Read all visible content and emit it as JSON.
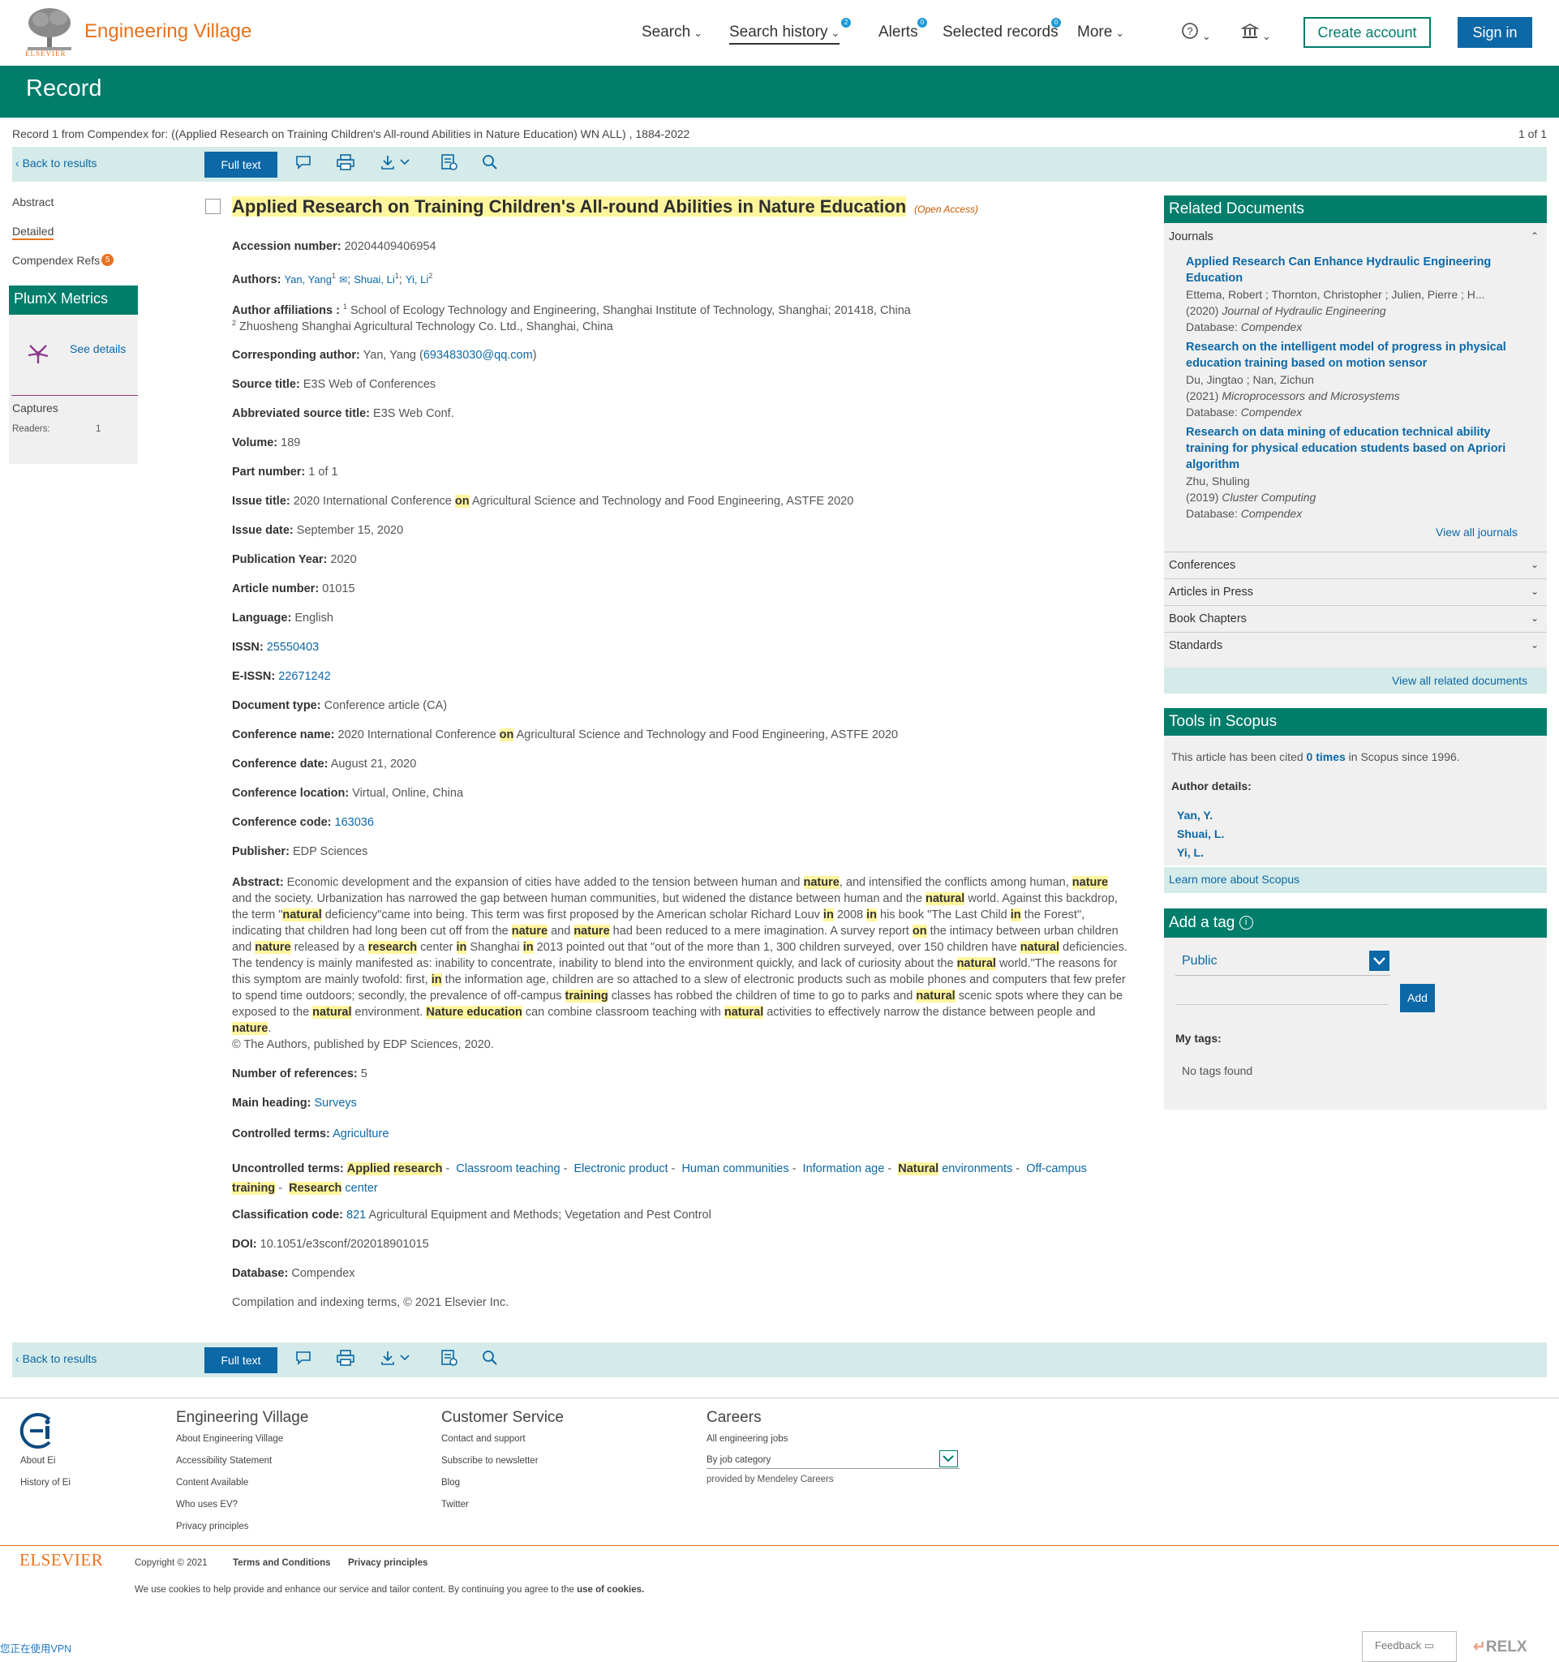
{
  "header": {
    "brand": "Engineering Village",
    "publisher_small": "ELSEVIER",
    "nav": [
      {
        "label": "Search",
        "badge": ""
      },
      {
        "label": "Search history",
        "badge": "2"
      },
      {
        "label": "Alerts",
        "badge": "0"
      },
      {
        "label": "Selected records",
        "badge": "0"
      },
      {
        "label": "More",
        "badge": ""
      }
    ],
    "help_icon": "question-circle-icon",
    "institution_icon": "institution-icon",
    "create_account": "Create account",
    "sign_in": "Sign in"
  },
  "page": {
    "title": "Record",
    "record_info": "Record 1 from Compendex for: ((Applied Research on Training Children's All-round Abilities in Nature Education) WN ALL) , 1884-2022",
    "record_count": "1 of 1",
    "back_to_results": "Back to results",
    "full_text": "Full text"
  },
  "sidebar": {
    "abstract": "Abstract",
    "detailed": "Detailed",
    "compendex_refs": "Compendex Refs",
    "refs_count": "5",
    "plumx_title": "PlumX Metrics",
    "see_details": "See details",
    "captures": "Captures",
    "readers_label": "Readers:",
    "readers_value": "1"
  },
  "record": {
    "title": "Applied Research on Training Children's All-round Abilities in Nature Education",
    "open_access": "(Open Access)",
    "accession_label": "Accession number:",
    "accession": "20204409406954",
    "authors_label": "Authors:",
    "author1": "Yan, Yang",
    "author2": "Shuai, Li",
    "author3": "Yi, Li",
    "affiliations_label": "Author affiliations :",
    "affiliation1": "School of Ecology Technology and Engineering, Shanghai Institute of Technology, Shanghai; 201418, China",
    "affiliation2": "Zhuosheng Shanghai Agricultural Technology Co. Ltd., Shanghai, China",
    "corresponding_label": "Corresponding author:",
    "corresponding_name": "Yan, Yang",
    "corresponding_email": "693483030@qq.com",
    "source_label": "Source title:",
    "source": "E3S Web of Conferences",
    "abbrev_label": "Abbreviated source title:",
    "abbrev": "E3S Web Conf.",
    "volume_label": "Volume:",
    "volume": "189",
    "part_label": "Part number:",
    "part": "1 of 1",
    "issue_title_label": "Issue title:",
    "issue_title_pre": "2020 International Conference",
    "issue_title_on": "on",
    "issue_title_post": "Agricultural Science and Technology and Food Engineering, ASTFE 2020",
    "issue_date_label": "Issue date:",
    "issue_date": "September 15, 2020",
    "pub_year_label": "Publication Year:",
    "pub_year": "2020",
    "article_label": "Article number:",
    "article": "01015",
    "language_label": "Language:",
    "language": "English",
    "issn_label": "ISSN:",
    "issn": "25550403",
    "eissn_label": "E-ISSN:",
    "eissn": "22671242",
    "doctype_label": "Document type:",
    "doctype": "Conference article (CA)",
    "conf_name_label": "Conference name:",
    "conf_name_pre": "2020 International Conference",
    "conf_name_on": "on",
    "conf_name_post": "Agricultural Science and Technology and Food Engineering, ASTFE 2020",
    "conf_date_label": "Conference date:",
    "conf_date": "August 21, 2020",
    "conf_loc_label": "Conference location:",
    "conf_loc": "Virtual, Online, China",
    "conf_code_label": "Conference code:",
    "conf_code": "163036",
    "publisher_label": "Publisher:",
    "publisher": "EDP Sciences",
    "abstract_label": "Abstract:",
    "abstract_copyright": "© The Authors, published by EDP Sciences, 2020.",
    "refs_label": "Number of references:",
    "refs": "5",
    "main_heading_label": "Main heading:",
    "main_heading": "Surveys",
    "controlled_label": "Controlled terms:",
    "controlled": "Agriculture",
    "uncontrolled_label": "Uncontrolled terms:",
    "class_label": "Classification code:",
    "class_code": "821",
    "class_text": "Agricultural Equipment and Methods; Vegetation and Pest Control",
    "doi_label": "DOI:",
    "doi": "10.1051/e3sconf/202018901015",
    "database_label": "Database:",
    "database": "Compendex",
    "compilation": "Compilation and indexing terms, © 2021 Elsevier Inc."
  },
  "related": {
    "title": "Related Documents",
    "journals": "Journals",
    "items": [
      {
        "title": "Applied Research Can Enhance Hydraulic Engineering Education",
        "authors": "Ettema, Robert ; Thornton, Christopher ; Julien, Pierre ; H...",
        "year": "(2020)",
        "journal": "Journal of Hydraulic Engineering",
        "db_label": "Database:",
        "db": "Compendex"
      },
      {
        "title": "Research on the intelligent model of progress in physical education training based on motion sensor",
        "authors": "Du, Jingtao ; Nan, Zichun",
        "year": "(2021)",
        "journal": "Microprocessors and Microsystems",
        "db_label": "Database:",
        "db": "Compendex"
      },
      {
        "title": "Research on data mining of education technical ability training for physical education students based on Apriori algorithm",
        "authors": "Zhu, Shuling",
        "year": "(2019)",
        "journal": "Cluster Computing",
        "db_label": "Database:",
        "db": "Compendex"
      }
    ],
    "view_all_journals": "View all journals",
    "conferences": "Conferences",
    "articles_in_press": "Articles in Press",
    "book_chapters": "Book Chapters",
    "standards": "Standards",
    "view_all_related": "View all related documents"
  },
  "scopus": {
    "title": "Tools in Scopus",
    "cited_pre": "This article has been cited",
    "cited_link": "0 times",
    "cited_post": "in Scopus since 1996.",
    "author_details": "Author details:",
    "authors": [
      "Yan, Y.",
      "Shuai, L.",
      "Yi, L."
    ],
    "learn_more": "Learn more about Scopus"
  },
  "tag": {
    "title": "Add a tag",
    "select_value": "Public",
    "add": "Add",
    "my_tags": "My tags:",
    "no_tags": "No tags found"
  },
  "footer": {
    "about_ei": "About Ei",
    "history_ei": "History of Ei",
    "col1_title": "Engineering Village",
    "col1": [
      "About Engineering Village",
      "Accessibility Statement",
      "Content Available",
      "Who uses EV?",
      "Privacy principles"
    ],
    "col2_title": "Customer Service",
    "col2": [
      "Contact and support",
      "Subscribe to newsletter",
      "Blog",
      "Twitter"
    ],
    "col3_title": "Careers",
    "col3_all": "All engineering jobs",
    "col3_select": "By job category",
    "col3_provided": "provided by Mendeley Careers",
    "elsevier": "ELSEVIER",
    "copyright": "Copyright © 2021",
    "terms": "Terms and Conditions",
    "privacy": "Privacy principles",
    "cookies_pre": "We use cookies to help provide and enhance our service and tailor content. By continuing you agree to the",
    "cookies_link": "use of cookies.",
    "vpn": "您正在使用VPN",
    "feedback": "Feedback",
    "relx": "RELX"
  },
  "colors": {
    "primary_green": "#007d6b",
    "link_blue": "#0c68a6",
    "brand_orange": "#e9711c",
    "highlight": "#fff59d"
  }
}
